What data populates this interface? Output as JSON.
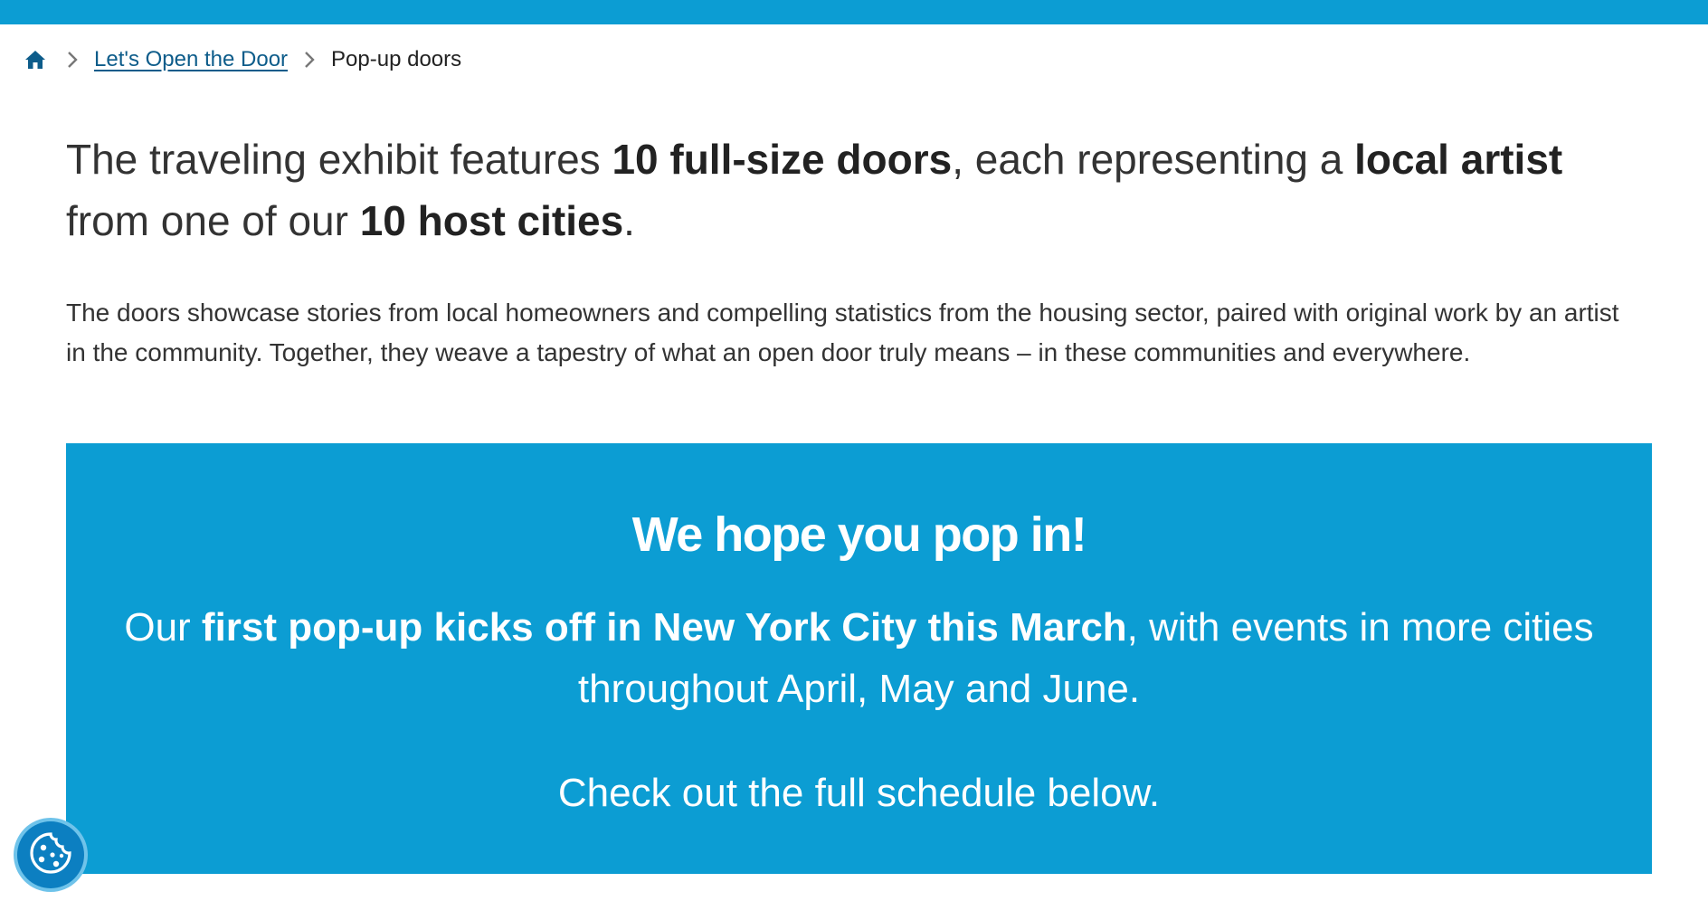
{
  "breadcrumb": {
    "home_icon": "home-icon",
    "separator_icon": "chevron-right-icon",
    "parent_label": "Let's Open the Door",
    "current_label": "Pop-up doors"
  },
  "intro": {
    "lead": {
      "t1": "The traveling exhibit features ",
      "b1": "10 full-size doors",
      "t2": ", each representing a ",
      "b2": "local artist",
      "t3": " from one of our ",
      "b3": "10 host cities",
      "t4": "."
    },
    "body": "The doors showcase stories from local homeowners and compelling statistics from the housing sector, paired with original work by an artist in the community. Together, they weave a tapestry of what an open door truly means – in these communities and everywhere."
  },
  "promo": {
    "heading": "We hope you pop in!",
    "line1_pre": "Our ",
    "line1_bold": "first pop-up kicks off in New York City this March",
    "line1_post": ", with events in more cities throughout April, May and June.",
    "line2": "Check out the full schedule below."
  },
  "cookie_button": {
    "icon": "cookie-icon"
  },
  "colors": {
    "accent_blue": "#0c9dd3",
    "link": "#0d5c8a",
    "cookie_bg": "#0c7fc1"
  }
}
